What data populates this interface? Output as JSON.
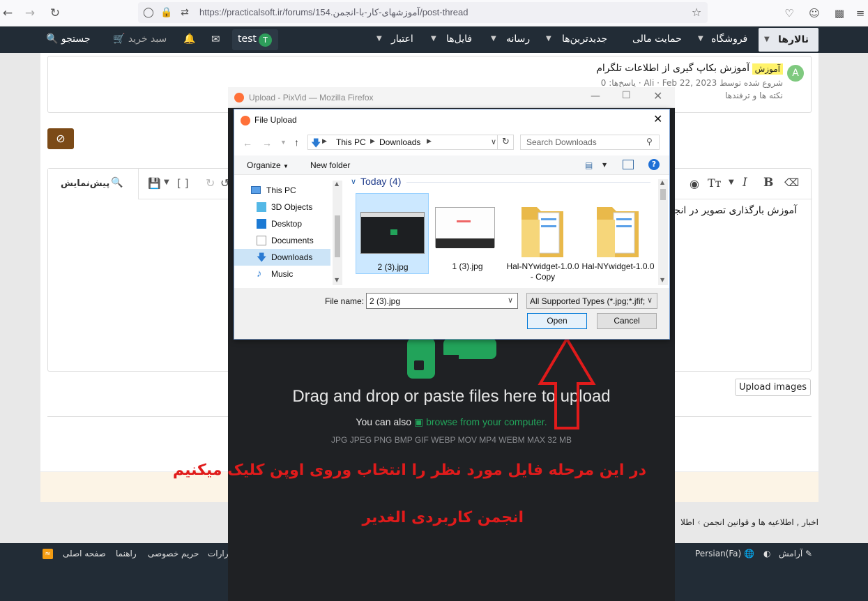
{
  "browser": {
    "url": "https://practicalsoft.ir/forums/154.آموزشهای-کار-با-انجمن/post-thread"
  },
  "forum_nav": {
    "items": [
      "تالارها",
      "فروشگاه",
      "حمایت مالی",
      "جدیدترین‌ها",
      "رسانه",
      "فایل‌ها",
      "اعتبار"
    ],
    "user": "test",
    "avatar_letter": "T",
    "cart": "سبد خرید",
    "search": "جستجو"
  },
  "thread_preview": {
    "badge": "آموزش",
    "title": "آموزش بکاپ گیری از اطلاعات تلگرام",
    "meta": "شروع شده توسط Ali · Feb 22, 2023 · پاسخ‌ها: 0",
    "forum": "نکته ها و ترفندها",
    "avatar_letter": "A"
  },
  "editor": {
    "preview_label": "پیش‌نمایش",
    "content": "آموزش بارگذاری تصویر در انجم",
    "upload_images": "Upload images"
  },
  "breadcrumb": {
    "items": [
      "اخبار , اطلاعیه ها و قوانین انجمن",
      "اطلا"
    ]
  },
  "footer": {
    "theme": "آرامش",
    "language": "Persian(Fa)",
    "links": [
      "صفحه اصلی",
      "راهنما",
      "حریم خصوصی",
      "قرارات"
    ]
  },
  "pixvid": {
    "window_title": "Upload - PixVid — Mozilla Firefox",
    "drag_text": "Drag and drop or paste files here to upload",
    "browse_prefix": "You can also",
    "browse_link": "browse from your computer.",
    "formats": "JPG JPEG PNG BMP GIF WEBP MOV MP4 WEBM   MAX 32 MB",
    "caption_1": "در این مرحله فایل مورد نظر را انتخاب وروی اوپن کلیک میکنیم",
    "caption_2": "انجمن کاربردی الغدیر",
    "accent": "#22a35a"
  },
  "dialog": {
    "title": "File Upload",
    "path": [
      "This PC",
      "Downloads"
    ],
    "search_placeholder": "Search Downloads",
    "organize": "Organize",
    "new_folder": "New folder",
    "tree": [
      "This PC",
      "3D Objects",
      "Desktop",
      "Documents",
      "Downloads",
      "Music"
    ],
    "group_label": "Today (4)",
    "files": [
      {
        "name": "2 (3).jpg",
        "selected": true
      },
      {
        "name": "1 (3).jpg",
        "selected": false
      },
      {
        "name": "Hal-NYwidget-1.0.0 - Copy",
        "selected": false
      },
      {
        "name": "Hal-NYwidget-1.0.0",
        "selected": false
      }
    ],
    "file_name_label": "File name:",
    "file_name_value": "2 (3).jpg",
    "filter": "All Supported Types (*.jpg;*.jfif;",
    "open": "Open",
    "cancel": "Cancel"
  }
}
